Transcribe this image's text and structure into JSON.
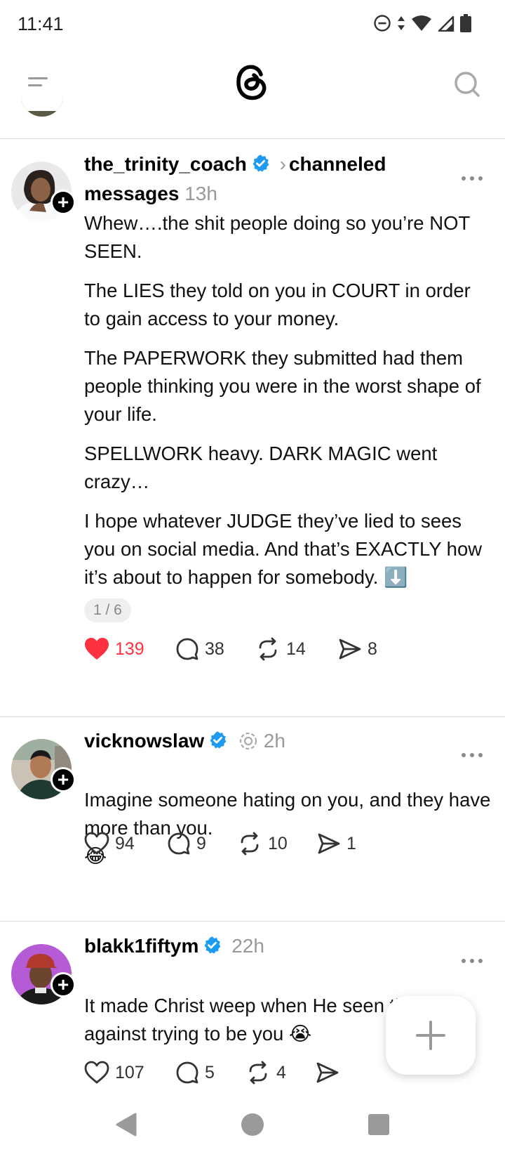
{
  "status_bar": {
    "time": "11:41",
    "icons": [
      "do-not-disturb-icon",
      "data-arrows-icon",
      "wifi-icon",
      "cell-signal-icon",
      "battery-icon"
    ]
  },
  "app_bar": {
    "icons": [
      "menu-icon",
      "threads-logo",
      "search-icon"
    ]
  },
  "posts": [
    {
      "username": "the_trinity_coach",
      "verified": true,
      "channel": "channeled messages",
      "time": "13h",
      "paragraphs": [
        "Whew….the shit people doing so you’re NOT SEEN.",
        "The LIES they told on you in COURT in order to gain access to your money.",
        "The PAPERWORK they submitted had them people thinking you were in the worst shape of your life.",
        "SPELLWORK heavy. DARK MAGIC went crazy…",
        "I hope whatever JUDGE they’ve lied to sees you on social media. And that’s EXACTLY how it’s about to happen for somebody. ⬇️"
      ],
      "thread_counter": "1 / 6",
      "likes": "139",
      "liked": true,
      "replies": "38",
      "reposts": "14",
      "shares": "8"
    },
    {
      "username": "vicknowslaw",
      "verified": true,
      "time": "2h",
      "paragraphs": [
        "Imagine someone hating on you, and they have more than you.",
        "😂"
      ],
      "likes": "94",
      "liked": false,
      "replies": "9",
      "reposts": "10",
      "shares": "1"
    },
    {
      "username": "blakk1fiftym",
      "verified": true,
      "time": "22h",
      "paragraphs": [
        "It made Christ weep when He seen the ones against trying to be you 😭"
      ],
      "likes": "107",
      "liked": false,
      "replies": "5",
      "reposts": "4",
      "shares": ""
    }
  ],
  "fab": {
    "icon": "plus-icon"
  },
  "nav_bar": {
    "icons": [
      "back-icon",
      "home-icon",
      "recents-icon"
    ]
  },
  "colors": {
    "like_red": "#ff3040",
    "verified_blue": "#1d9bf0",
    "muted_text": "#999999"
  }
}
